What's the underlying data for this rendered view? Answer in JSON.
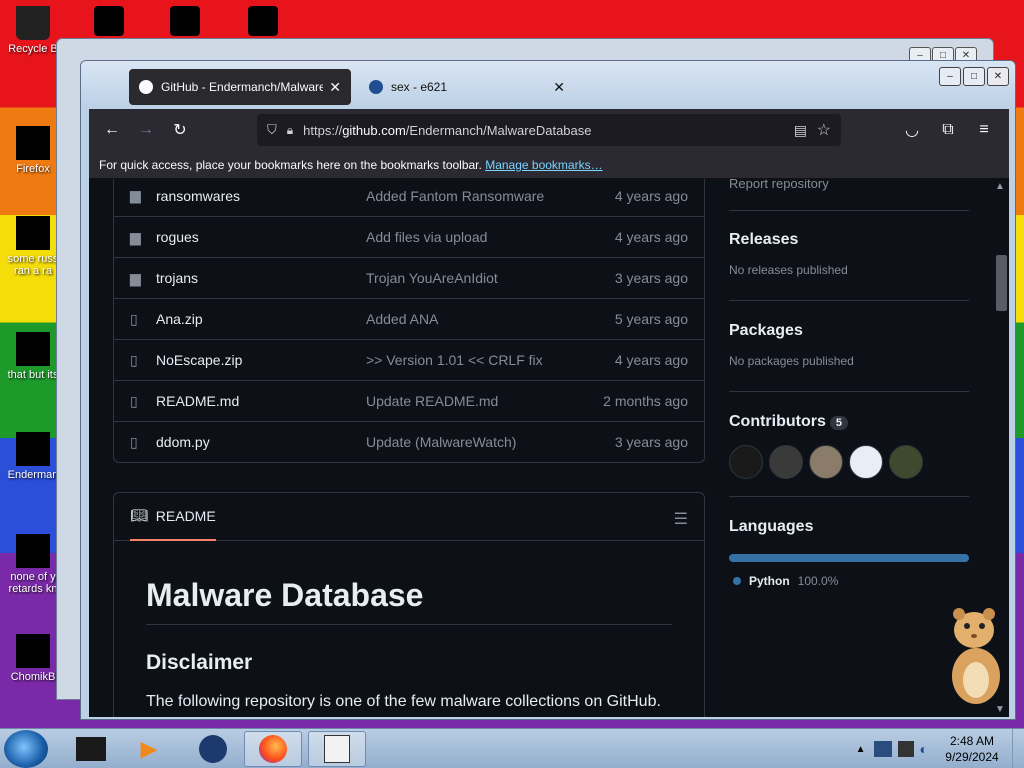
{
  "desktop": {
    "icons": [
      {
        "label": "Recycle B"
      },
      {
        "label": "Firefox"
      },
      {
        "label": "some russ ran a ra"
      },
      {
        "label": "that but its"
      },
      {
        "label": "Enderman"
      },
      {
        "label": "none of y retards kn"
      },
      {
        "label": "ChomikB"
      }
    ]
  },
  "back_window": {
    "min": "–",
    "max": "□",
    "close": "✕"
  },
  "browser": {
    "tabs": [
      {
        "title": "GitHub - Endermanch/MalwareDatabase",
        "close": "✕",
        "active": true
      },
      {
        "title": "sex - e621",
        "close": "✕",
        "active": false
      }
    ],
    "window_buttons": {
      "min": "–",
      "max": "□",
      "close": "✕"
    },
    "url": {
      "prefix": "https://",
      "domain": "github.com",
      "path": "/Endermanch/MalwareDatabase"
    },
    "bookmarks_bar": {
      "text": "For quick access, place your bookmarks here on the bookmarks toolbar.",
      "link": "Manage bookmarks…"
    }
  },
  "repo": {
    "files": [
      {
        "name": "ransomwares",
        "type": "folder",
        "message": "Added Fantom Ransomware",
        "age": "4 years ago"
      },
      {
        "name": "rogues",
        "type": "folder",
        "message": "Add files via upload",
        "age": "4 years ago"
      },
      {
        "name": "trojans",
        "type": "folder",
        "message": "Trojan YouAreAnIdiot",
        "age": "3 years ago"
      },
      {
        "name": "Ana.zip",
        "type": "file",
        "message": "Added ANA",
        "age": "5 years ago"
      },
      {
        "name": "NoEscape.zip",
        "type": "file",
        "message": ">> Version 1.01 << CRLF fix",
        "age": "4 years ago"
      },
      {
        "name": "README.md",
        "type": "file",
        "message": "Update README.md",
        "age": "2 months ago"
      },
      {
        "name": "ddom.py",
        "type": "file",
        "message": "Update (MalwareWatch)",
        "age": "3 years ago"
      }
    ],
    "readme": {
      "tab_label": "README",
      "h1": "Malware Database",
      "h2": "Disclaimer",
      "p": "The following repository is one of the few malware collections on GitHub."
    },
    "sidebar": {
      "report": "Report repository",
      "releases": {
        "title": "Releases",
        "sub": "No releases published"
      },
      "packages": {
        "title": "Packages",
        "sub": "No packages published"
      },
      "contributors": {
        "title": "Contributors",
        "count": "5"
      },
      "languages": {
        "title": "Languages",
        "items": [
          {
            "name": "Python",
            "percent": "100.0%",
            "color": "#3572a5"
          }
        ]
      }
    }
  },
  "taskbar": {
    "time": "2:48 AM",
    "date": "9/29/2024"
  }
}
